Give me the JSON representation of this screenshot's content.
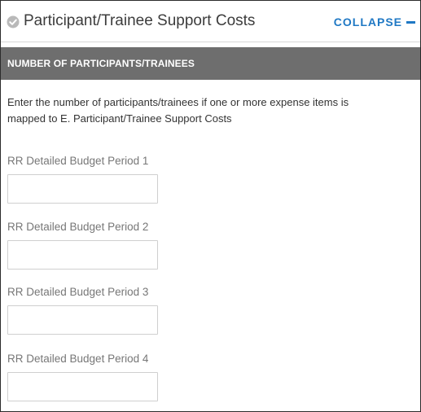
{
  "panel": {
    "title": "Participant/Trainee Support Costs",
    "collapse_label": "COLLAPSE",
    "status_icon": "check-circle-icon",
    "accent_color": "#1f78c4"
  },
  "section": {
    "header": "NUMBER OF PARTICIPANTS/TRAINEES",
    "bar_color": "#6e6e6e",
    "intro_text": "Enter the number of participants/trainees if one or more expense items is mapped to E. Participant/Trainee Support Costs"
  },
  "fields": [
    {
      "label": "RR Detailed Budget Period 1",
      "value": ""
    },
    {
      "label": "RR Detailed Budget Period 2",
      "value": ""
    },
    {
      "label": "RR Detailed Budget Period 3",
      "value": ""
    },
    {
      "label": "RR Detailed Budget Period 4",
      "value": ""
    }
  ]
}
